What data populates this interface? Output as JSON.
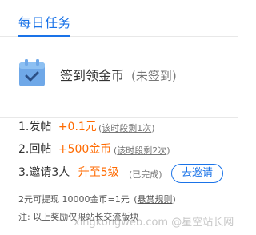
{
  "header": {
    "title": "每日任务"
  },
  "signin": {
    "label": "签到领金币",
    "status": "(未签到)"
  },
  "tasks": [
    {
      "label": "1.发帖",
      "reward": "+0.1元",
      "limit_prefix": "(",
      "limit": "该时段剩1次",
      "limit_suffix": ")"
    },
    {
      "label": "2.回帖",
      "reward": "+500金币",
      "limit_prefix": "(",
      "limit": "该时段剩2次",
      "limit_suffix": ")"
    },
    {
      "label": "3.邀请3人",
      "reward": "升至5级",
      "limit": "(已完成)",
      "button": "去邀请"
    }
  ],
  "footer": {
    "exchange_text": "2元可提现 10000金币=1元",
    "rules_link": "悬赏规则",
    "rules_prefix": "(",
    "rules_suffix": ")",
    "note": "注:  以上奖励仅限站长交流版块"
  },
  "watermark": "xingkongweb.com @星空站长网",
  "colors": {
    "accent": "#1a73e8",
    "reward": "#ff6a00"
  }
}
